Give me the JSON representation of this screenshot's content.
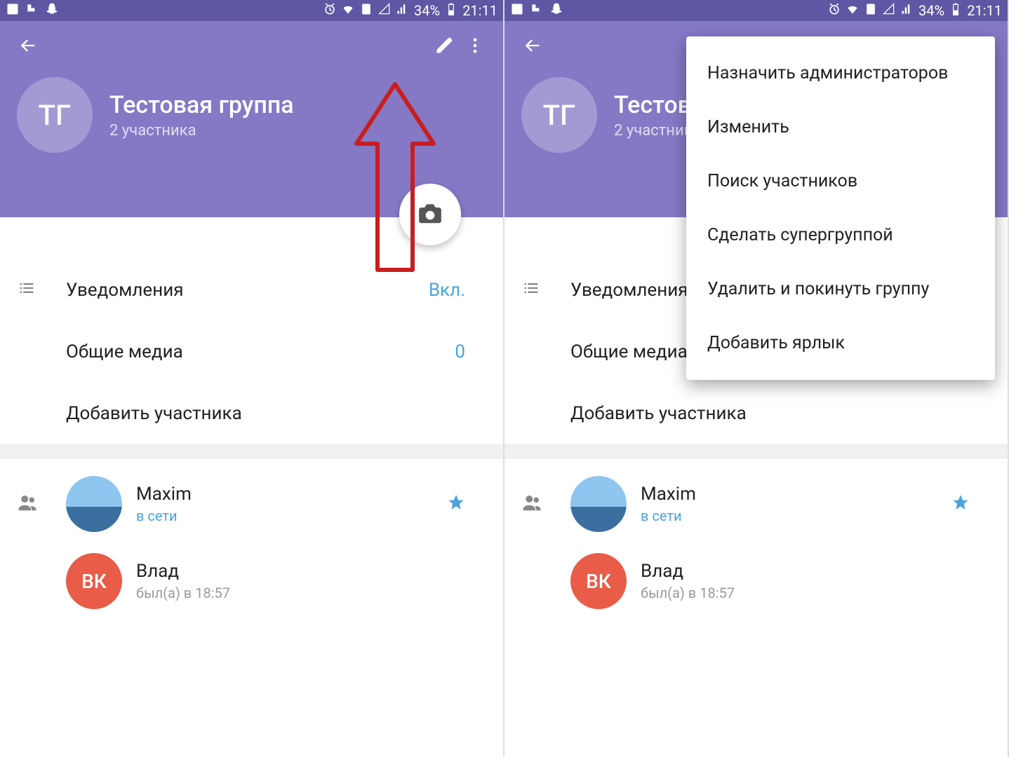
{
  "statusbar": {
    "battery_percent": "34%",
    "time": "21:11"
  },
  "group": {
    "avatar_initials": "ТГ",
    "title": "Тестовая группа",
    "subtitle": "2 участника"
  },
  "settings": {
    "notifications_label": "Уведомления",
    "notifications_value": "Вкл.",
    "shared_media_label": "Общие медиа",
    "shared_media_value": "0",
    "add_member_label": "Добавить участника"
  },
  "members": {
    "0": {
      "name": "Maxim",
      "status": "в сети"
    },
    "1": {
      "name": "Влад",
      "status": "был(а) в 18:57",
      "avatar_initials": "ВК"
    }
  },
  "menu": {
    "0": "Назначить администраторов",
    "1": "Изменить",
    "2": "Поиск участников",
    "3": "Сделать супергруппой",
    "4": "Удалить и покинуть группу",
    "5": "Добавить ярлык"
  }
}
